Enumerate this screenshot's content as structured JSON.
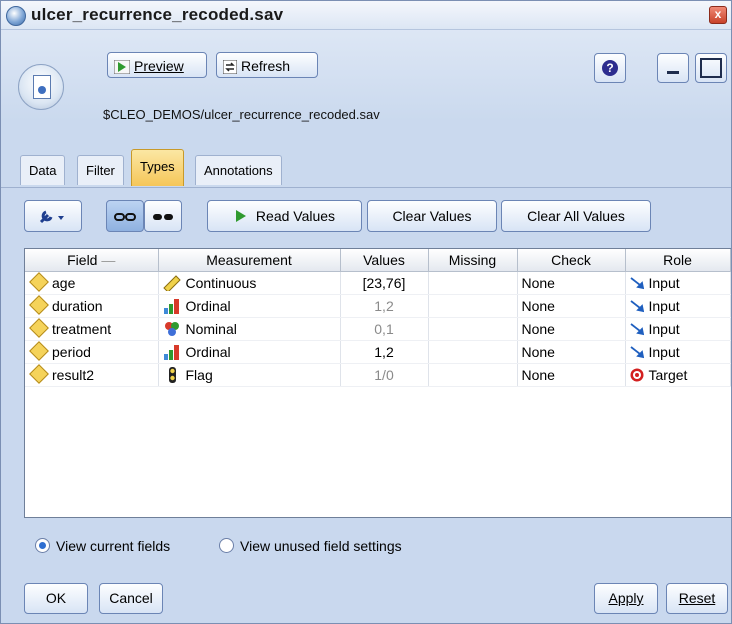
{
  "window": {
    "title": "ulcer_recurrence_recoded.sav",
    "close_label": "x"
  },
  "toolbar": {
    "preview_label": "Preview",
    "refresh_label": "Refresh",
    "help_label": "?"
  },
  "path": "$CLEO_DEMOS/ulcer_recurrence_recoded.sav",
  "tabs": [
    {
      "label": "Data",
      "active": false
    },
    {
      "label": "Filter",
      "active": false
    },
    {
      "label": "Types",
      "active": true
    },
    {
      "label": "Annotations",
      "active": false
    }
  ],
  "actions": {
    "read_values": "Read Values",
    "clear_values": "Clear Values",
    "clear_all_values": "Clear All Values"
  },
  "table": {
    "headers": [
      "Field",
      "Measurement",
      "Values",
      "Missing",
      "Check",
      "Role"
    ],
    "sort_indicator": "—",
    "rows": [
      {
        "field": "age",
        "measurement": "Continuous",
        "values": "[23,76]",
        "missing": "",
        "check": "None",
        "role": "Input"
      },
      {
        "field": "duration",
        "measurement": "Ordinal",
        "values": "1,2",
        "missing": "",
        "check": "None",
        "role": "Input"
      },
      {
        "field": "treatment",
        "measurement": "Nominal",
        "values": "0,1",
        "missing": "",
        "check": "None",
        "role": "Input"
      },
      {
        "field": "period",
        "measurement": "Ordinal",
        "values": "1,2",
        "missing": "",
        "check": "None",
        "role": "Input"
      },
      {
        "field": "result2",
        "measurement": "Flag",
        "values": "1/0",
        "missing": "",
        "check": "None",
        "role": "Target"
      }
    ]
  },
  "view_options": {
    "current": "View current fields",
    "unused": "View unused field settings",
    "selected": "current"
  },
  "buttons": {
    "ok": "OK",
    "cancel": "Cancel",
    "apply": "Apply",
    "reset": "Reset"
  },
  "colors": {
    "active_tab": "#f5c659",
    "panel_bg": "#c9d8ee",
    "input_arrow": "#1f5fbf",
    "target_red": "#d32020"
  }
}
